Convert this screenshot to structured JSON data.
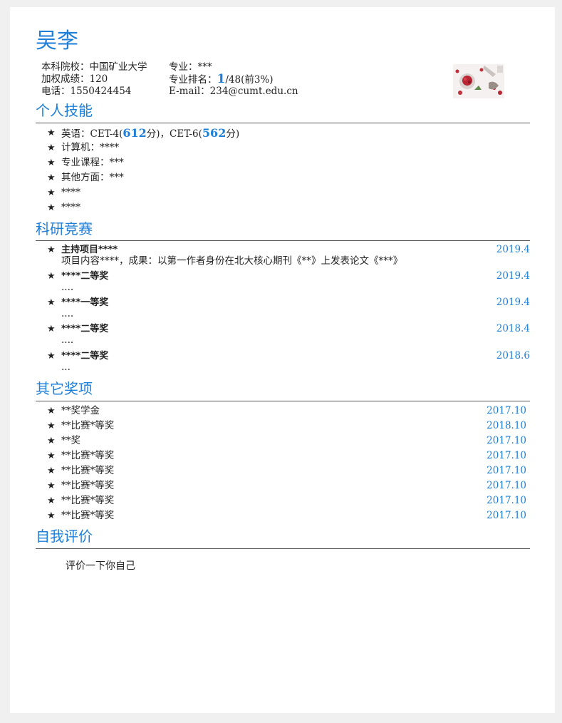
{
  "name": "吴李",
  "info": {
    "school_label": "本科院校：",
    "school": "中国矿业大学",
    "major_label": "专业：",
    "major": "***",
    "gpa_label": "加权成绩：",
    "gpa": "120",
    "rank_label": "专业排名：",
    "rank_num": "1",
    "rank_rest": "/48(前3%)",
    "phone_label": "电话：",
    "phone": "1550424454",
    "email_label": "E-mail：",
    "email": "234@cumt.edu.cn"
  },
  "colors": {
    "accent": "#1e7fd8",
    "rule": "#555555",
    "background": "#f0f0f0"
  },
  "skills": {
    "title": "个人技能",
    "bullet_icon": "star-icon",
    "english_prefix": "英语：CET-4(",
    "cet4_score": "612",
    "english_mid": "分)，CET-6(",
    "cet6_score": "562",
    "english_suffix": "分)",
    "items": [
      "计算机：****",
      "专业课程：***",
      "其他方面：***",
      "****",
      "****"
    ]
  },
  "research": {
    "title": "科研竞赛",
    "items": [
      {
        "title": "主持项目****",
        "date": "2019.4",
        "detail": "项目内容****，成果：以第一作者身份在北大核心期刊《**》上发表论文《***》"
      },
      {
        "title": "****二等奖",
        "date": "2019.4",
        "detail": "...."
      },
      {
        "title": "****一等奖",
        "date": "2019.4",
        "detail": "...."
      },
      {
        "title": "****二等奖",
        "date": "2018.4",
        "detail": "...."
      },
      {
        "title": "****二等奖",
        "date": "2018.6",
        "detail": "..."
      }
    ]
  },
  "awards": {
    "title": "其它奖项",
    "items": [
      {
        "title": "**奖学金",
        "date": "2017.10"
      },
      {
        "title": "**比赛*等奖",
        "date": "2018.10"
      },
      {
        "title": "**奖",
        "date": "2017.10"
      },
      {
        "title": "**比赛*等奖",
        "date": "2017.10"
      },
      {
        "title": "**比赛*等奖",
        "date": "2017.10"
      },
      {
        "title": "**比赛*等奖",
        "date": "2017.10"
      },
      {
        "title": "**比赛*等奖",
        "date": "2017.10"
      },
      {
        "title": "**比赛*等奖",
        "date": "2017.10"
      }
    ]
  },
  "self_eval": {
    "title": "自我评价",
    "text": "评价一下你自己"
  }
}
